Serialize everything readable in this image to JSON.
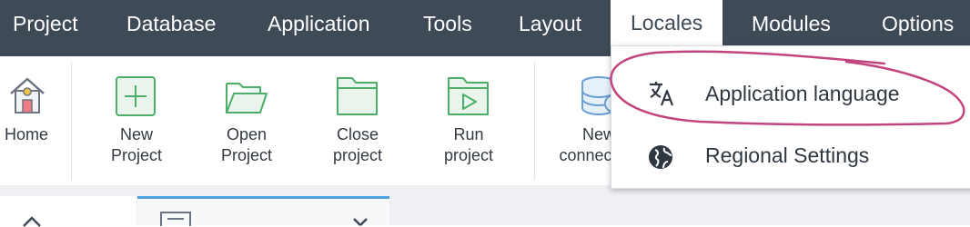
{
  "menubar": {
    "items": [
      {
        "label": "Project"
      },
      {
        "label": "Database"
      },
      {
        "label": "Application"
      },
      {
        "label": "Tools"
      },
      {
        "label": "Layout"
      },
      {
        "label": "Locales"
      },
      {
        "label": "Modules"
      },
      {
        "label": "Options"
      }
    ],
    "active_item": "Locales",
    "background": "#3f4a57"
  },
  "toolbar": {
    "home": {
      "label": "Home",
      "icon": "house-icon"
    },
    "new_project": {
      "label_line1": "New",
      "label_line2": "Project",
      "icon": "plus-square-icon"
    },
    "open_project": {
      "label_line1": "Open",
      "label_line2": "Project",
      "icon": "open-folder-icon"
    },
    "close_project": {
      "label_line1": "Close",
      "label_line2": "project",
      "icon": "folder-icon"
    },
    "run_project": {
      "label_line1": "Run",
      "label_line2": "project",
      "icon": "play-folder-icon"
    },
    "new_connection": {
      "label_line1": "New",
      "label_line2": "connection",
      "icon": "database-icon"
    },
    "icon_color": "#4cae69"
  },
  "locales_menu": {
    "items": [
      {
        "label": "Application language",
        "icon": "translate-icon"
      },
      {
        "label": "Regional Settings",
        "icon": "globe-icon"
      }
    ]
  },
  "annotation": {
    "color": "#c2447e"
  },
  "tabs": {
    "active_accent": "#4aa3df"
  }
}
